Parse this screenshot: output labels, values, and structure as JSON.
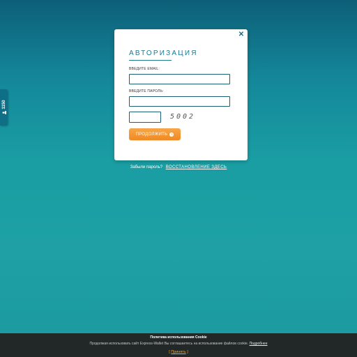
{
  "side_tab": {
    "count": "1150",
    "icon": "user-icon"
  },
  "modal": {
    "close_icon": "close-icon",
    "title": "АВТОРИЗАЦИЯ",
    "email_label": "ВВЕДИТЕ EMAIL:",
    "email_value": "",
    "password_label": "ВВЕДИТЕ ПАРОЛЬ:",
    "password_value": "",
    "captcha_value": "",
    "captcha_code": "5002",
    "submit_label": "ПРОДОЛЖИТЬ",
    "submit_icon": "arrow-right-icon"
  },
  "forgot": {
    "question": "Забыли пароль?",
    "link": "ВОССТАНОВЛЕНИЕ ЗДЕСЬ"
  },
  "cookie": {
    "title": "Политика использования Cookie",
    "text": "Продолжая использовать сайт Express-Wallet Вы соглашаетесь на использование файлов cookie.",
    "more_link": "Подробнее",
    "accept_label": "Принять",
    "bracket_open": "[",
    "bracket_close": "]"
  },
  "colors": {
    "background_top": "#0d5f78",
    "background_main": "#1ea0a4",
    "accent_teal": "#1a7a8e",
    "button_orange": "#ef8a22",
    "cookie_bar": "#222728",
    "cookie_accept": "#f4a534"
  }
}
